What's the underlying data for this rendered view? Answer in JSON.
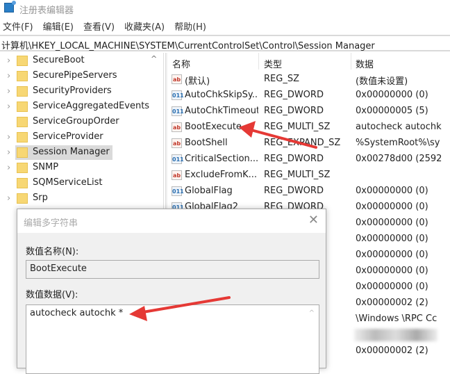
{
  "window": {
    "title": "注册表编辑器",
    "icon": "registry-editor-icon"
  },
  "menu": [
    "文件(F)",
    "编辑(E)",
    "查看(V)",
    "收藏夹(A)",
    "帮助(H)"
  ],
  "address": "计算机\\HKEY_LOCAL_MACHINE\\SYSTEM\\CurrentControlSet\\Control\\Session Manager",
  "tree": {
    "items": [
      {
        "label": "SecureBoot",
        "expandable": true
      },
      {
        "label": "SecurePipeServers",
        "expandable": true
      },
      {
        "label": "SecurityProviders",
        "expandable": true
      },
      {
        "label": "ServiceAggregatedEvents",
        "expandable": true
      },
      {
        "label": "ServiceGroupOrder",
        "expandable": false
      },
      {
        "label": "ServiceProvider",
        "expandable": true
      },
      {
        "label": "Session Manager",
        "expandable": true,
        "selected": true
      },
      {
        "label": "SNMP",
        "expandable": true
      },
      {
        "label": "SQMServiceList",
        "expandable": false
      },
      {
        "label": "Srp",
        "expandable": true
      }
    ]
  },
  "list": {
    "columns": [
      "名称",
      "类型",
      "数据"
    ],
    "rows": [
      {
        "icon": "ab",
        "name": "(默认)",
        "type": "REG_SZ",
        "data": "(数值未设置)"
      },
      {
        "icon": "dw",
        "name": "AutoChkSkipSy...",
        "type": "REG_DWORD",
        "data": "0x00000000 (0)"
      },
      {
        "icon": "dw",
        "name": "AutoChkTimeout",
        "type": "REG_DWORD",
        "data": "0x00000005 (5)"
      },
      {
        "icon": "ab",
        "name": "BootExecute",
        "type": "REG_MULTI_SZ",
        "data": "autocheck autochk"
      },
      {
        "icon": "ab",
        "name": "BootShell",
        "type": "REG_EXPAND_SZ",
        "data": "%SystemRoot%\\sy"
      },
      {
        "icon": "dw",
        "name": "CriticalSection...",
        "type": "REG_DWORD",
        "data": "0x00278d00 (2592"
      },
      {
        "icon": "ab",
        "name": "ExcludeFromK...",
        "type": "REG_MULTI_SZ",
        "data": ""
      },
      {
        "icon": "dw",
        "name": "GlobalFlag",
        "type": "REG_DWORD",
        "data": "0x00000000 (0)"
      },
      {
        "icon": "dw",
        "name": "GlobalFlag2",
        "type": "REG_DWORD",
        "data": "0x00000000 (0)"
      },
      {
        "icon": "dw",
        "name": "",
        "type": "",
        "data": "0x00000000 (0)"
      },
      {
        "icon": "dw",
        "name": "",
        "type": "",
        "data": "0x00000000 (0)"
      },
      {
        "icon": "dw",
        "name": "",
        "type": "",
        "data": "0x00000000 (0)"
      },
      {
        "icon": "dw",
        "name": "",
        "type": "",
        "data": "0x00000000 (0)"
      },
      {
        "icon": "dw",
        "name": "",
        "type": "",
        "data": "0x00000000 (0)"
      },
      {
        "icon": "dw",
        "name": "",
        "type": "",
        "data": "0x00000002 (2)"
      },
      {
        "icon": "ab",
        "name": "",
        "type": "Z",
        "data": "\\Windows \\RPC Cc"
      },
      {
        "icon": "ab",
        "name": "",
        "type": "Z",
        "data": "",
        "blurred": true
      },
      {
        "icon": "dw",
        "name": "",
        "type": "",
        "data": "0x00000002 (2)"
      }
    ]
  },
  "dialog": {
    "title": "编辑多字符串",
    "close_icon": "close-icon",
    "name_label": "数值名称(N):",
    "name_value": "BootExecute",
    "data_label": "数值数据(V):",
    "data_value": "autocheck autochk *"
  },
  "annotations": {
    "arrow_color": "#e53935"
  }
}
